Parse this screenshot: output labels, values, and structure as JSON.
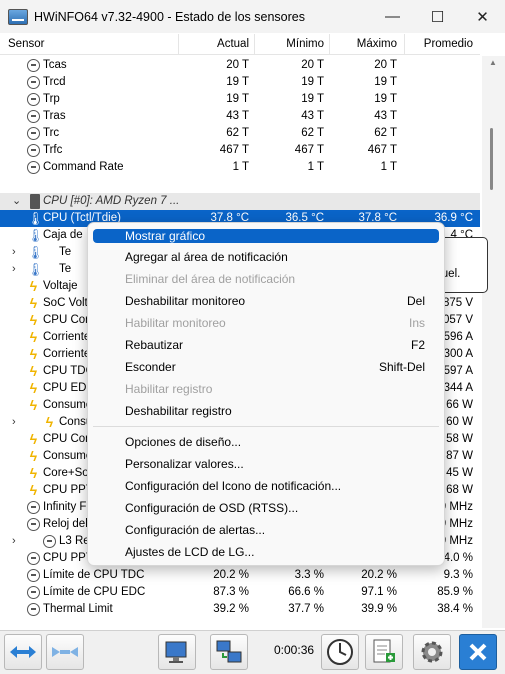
{
  "window": {
    "title": "HWiNFO64 v7.32-4900 - Estado de los sensores",
    "minimize_glyph": "—",
    "maximize_glyph": "☐",
    "close_glyph": "✕"
  },
  "columns": {
    "sensor": "Sensor",
    "actual": "Actual",
    "minimo": "Mínimo",
    "maximo": "Máximo",
    "promedio": "Promedio"
  },
  "rows": [
    {
      "name": "Tcas",
      "actual": "20 T",
      "min": "20 T",
      "max": "20 T",
      "avg": ""
    },
    {
      "name": "Trcd",
      "actual": "19 T",
      "min": "19 T",
      "max": "19 T",
      "avg": ""
    },
    {
      "name": "Trp",
      "actual": "19 T",
      "min": "19 T",
      "max": "19 T",
      "avg": ""
    },
    {
      "name": "Tras",
      "actual": "43 T",
      "min": "43 T",
      "max": "43 T",
      "avg": ""
    },
    {
      "name": "Trc",
      "actual": "62 T",
      "min": "62 T",
      "max": "62 T",
      "avg": ""
    },
    {
      "name": "Trfc",
      "actual": "467 T",
      "min": "467 T",
      "max": "467 T",
      "avg": ""
    },
    {
      "name": "Command Rate",
      "actual": "1 T",
      "min": "1 T",
      "max": "1 T",
      "avg": ""
    },
    {
      "name": "",
      "actual": "",
      "min": "",
      "max": "",
      "avg": ""
    },
    {
      "name": "CPU [#0]: AMD Ryzen 7 ...",
      "actual": "",
      "min": "",
      "max": "",
      "avg": ""
    },
    {
      "name": "CPU (Tctl/Tdie)",
      "actual": "37.8 °C",
      "min": "36.5 °C",
      "max": "37.8 °C",
      "avg": "36.9 °C"
    },
    {
      "name": "Caja de",
      "actual": "",
      "min": "",
      "max": "",
      "avg": "4 °C"
    },
    {
      "name": "Te",
      "actual": "",
      "min": "",
      "max": "",
      "avg": ""
    },
    {
      "name": "Te",
      "actual": "",
      "min": "",
      "max": "",
      "avg": ""
    },
    {
      "name": "Voltaje",
      "actual": "",
      "min": "",
      "max": "",
      "avg": ""
    },
    {
      "name": "SoC Volta",
      "actual": "",
      "min": "",
      "max": "",
      "avg": "875 V"
    },
    {
      "name": "CPU Core",
      "actual": "",
      "min": "",
      "max": "",
      "avg": "057 V"
    },
    {
      "name": "Corriente",
      "actual": "",
      "min": "",
      "max": "",
      "avg": "596 A"
    },
    {
      "name": "Corriente",
      "actual": "",
      "min": "",
      "max": "",
      "avg": "300 A"
    },
    {
      "name": "CPU TDC",
      "actual": "",
      "min": "",
      "max": "",
      "avg": "597 A"
    },
    {
      "name": "CPU EDC",
      "actual": "",
      "min": "",
      "max": "",
      "avg": "344 A"
    },
    {
      "name": "Consumo",
      "actual": "",
      "min": "",
      "max": "",
      "avg": "66 W"
    },
    {
      "name": "Consu",
      "actual": "",
      "min": "",
      "max": "",
      "avg": "60 W"
    },
    {
      "name": "CPU Con",
      "actual": "",
      "min": "",
      "max": "",
      "avg": "58 W"
    },
    {
      "name": "Consumo",
      "actual": "",
      "min": "",
      "max": "",
      "avg": "87 W"
    },
    {
      "name": "Core+So",
      "actual": "",
      "min": "",
      "max": "",
      "avg": "45 W"
    },
    {
      "name": "CPU PPT",
      "actual": "",
      "min": "",
      "max": "",
      "avg": "68 W"
    },
    {
      "name": "Infinity F",
      "actual": "",
      "min": "",
      "max": "",
      "avg": "9 MHz"
    },
    {
      "name": "Reloj del",
      "actual": "",
      "min": "",
      "max": "",
      "avg": "9 MHz"
    },
    {
      "name": "L3 Re",
      "actual": "",
      "min": "",
      "max": "",
      "avg": "9 MHz"
    },
    {
      "name": "CPU PPT",
      "actual": "",
      "min": "",
      "max": "",
      "avg": "4.0 %"
    },
    {
      "name": "Límite de CPU TDC",
      "actual": "20.2 %",
      "min": "3.3 %",
      "max": "20.2 %",
      "avg": "9.3 %"
    },
    {
      "name": "Límite de CPU EDC",
      "actual": "87.3 %",
      "min": "66.6 %",
      "max": "97.1 %",
      "avg": "85.9 %"
    },
    {
      "name": "Thermal Limit",
      "actual": "39.2 %",
      "min": "37.7 %",
      "max": "39.9 %",
      "avg": "38.4 %"
    }
  ],
  "tooltip": {
    "text": "oquel."
  },
  "context_menu": {
    "items": [
      {
        "label": "Mostrar gráfico",
        "shortcut": ""
      },
      {
        "label": "Agregar al área de notificación",
        "shortcut": ""
      },
      {
        "label": "Eliminar del área de notificación",
        "shortcut": ""
      },
      {
        "label": "Deshabilitar monitoreo",
        "shortcut": "Del"
      },
      {
        "label": "Habilitar monitoreo",
        "shortcut": "Ins"
      },
      {
        "label": "Rebautizar",
        "shortcut": "F2"
      },
      {
        "label": "Esconder",
        "shortcut": "Shift-Del"
      },
      {
        "label": "Habilitar registro",
        "shortcut": ""
      },
      {
        "label": "Deshabilitar registro",
        "shortcut": ""
      },
      {
        "label": "Opciones de diseño...",
        "shortcut": ""
      },
      {
        "label": "Personalizar valores...",
        "shortcut": ""
      },
      {
        "label": "Configuración del Icono de notificación...",
        "shortcut": ""
      },
      {
        "label": "Configuración de OSD (RTSS)...",
        "shortcut": ""
      },
      {
        "label": "Configuración de alertas...",
        "shortcut": ""
      },
      {
        "label": "Ajustes de LCD de LG...",
        "shortcut": ""
      }
    ]
  },
  "toolbar": {
    "timer": "0:00:36"
  },
  "colors": {
    "selection": "#0a64c8",
    "bolt": "#f0b400",
    "thermometer": "#3a78c9",
    "close_button": "#2a7fd4"
  }
}
